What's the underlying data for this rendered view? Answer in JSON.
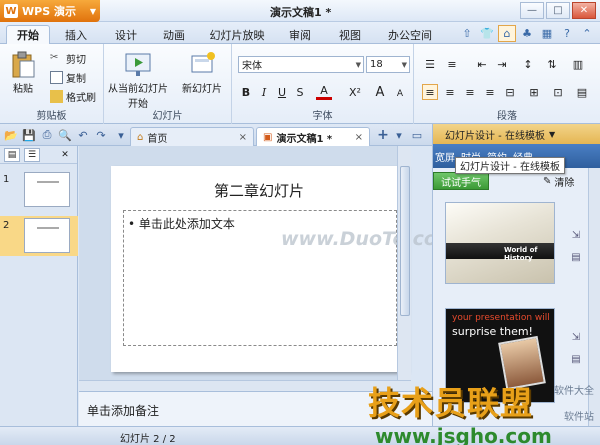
{
  "app": {
    "menu_label": "WPS 演示",
    "doc_title": "演示文稿1 *"
  },
  "window": {
    "minimize": "—",
    "restore": "□",
    "close": "✕"
  },
  "menu": {
    "tabs": [
      "开始",
      "插入",
      "设计",
      "动画",
      "幻灯片放映",
      "审阅",
      "视图",
      "办公空间"
    ],
    "active": 0
  },
  "ribbon": {
    "clipboard": {
      "paste": "粘贴",
      "cut": "剪切",
      "copy": "复制",
      "format_painter": "格式刷",
      "label": "剪贴板"
    },
    "slides": {
      "from_current": "从当前幻灯片",
      "from_current_2": "开始",
      "new_slide": "新幻灯片",
      "label": "幻灯片"
    },
    "font": {
      "family": "宋体",
      "size": "18",
      "bold": "B",
      "italic": "I",
      "underline": "U",
      "strike": "S",
      "superscript": "X²",
      "grow": "A",
      "shrink": "A",
      "label": "字体"
    },
    "paragraph": {
      "label": "段落"
    }
  },
  "docbar": {
    "tabs": [
      {
        "label": "首页",
        "close": "×"
      },
      {
        "label": "演示文稿1 *",
        "close": "×"
      }
    ],
    "new_tab": "+"
  },
  "slide_panel": {
    "thumbs": [
      {
        "num": "1"
      },
      {
        "num": "2"
      }
    ],
    "selected": 1
  },
  "slide": {
    "title": "第二章幻灯片",
    "body_placeholder": "• 单击此处添加文本"
  },
  "watermark": "www.DuoTe.com",
  "notes_placeholder": "单击添加备注",
  "taskpane": {
    "header": "幻灯片设计 - 在线模板",
    "subtabs": [
      "宽屏",
      "时尚",
      "简约",
      "经典"
    ],
    "tooltip": "幻灯片设计 - 在线模板",
    "try_button": "试试手气",
    "clear_button": "清除",
    "template1_text": "World of History",
    "template2_line1": "your presentation will",
    "template2_line2": "surprise them!"
  },
  "brand": {
    "text": "技术员联盟",
    "side1": "软件大全",
    "side2": "软件站"
  },
  "status": {
    "slide_count": "幻灯片 2 / 2",
    "url": "www.jsgho.com"
  }
}
